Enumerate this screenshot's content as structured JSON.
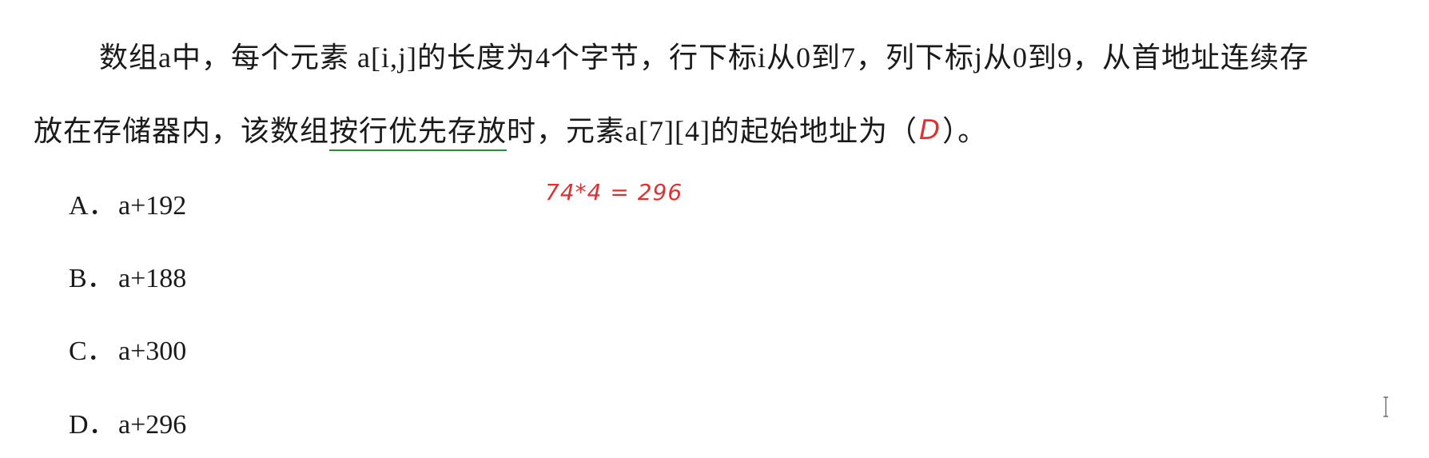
{
  "question": {
    "line1": "数组a中，每个元素  a[i,j]的长度为4个字节，行下标i从0到7，列下标j从0到9，从首地址连续存",
    "line2_before": "放在存储器内，该数组",
    "line2_underlined": "按行优先存放",
    "line2_after": "时，元素a[7][4]的起始地址为（",
    "answer_handwritten": "D",
    "line2_end": "）。"
  },
  "annotation": "74*4 = 296",
  "options": [
    {
      "letter": "A．",
      "text": "a+192"
    },
    {
      "letter": "B．",
      "text": "a+188"
    },
    {
      "letter": "C．",
      "text": "a+300"
    },
    {
      "letter": "D．",
      "text": "a+296"
    }
  ],
  "colors": {
    "annotation": "#e03030",
    "underline": "#2e8b3a",
    "text": "#1a1a1a"
  },
  "icons": {
    "cursor": "text-cursor-icon"
  }
}
